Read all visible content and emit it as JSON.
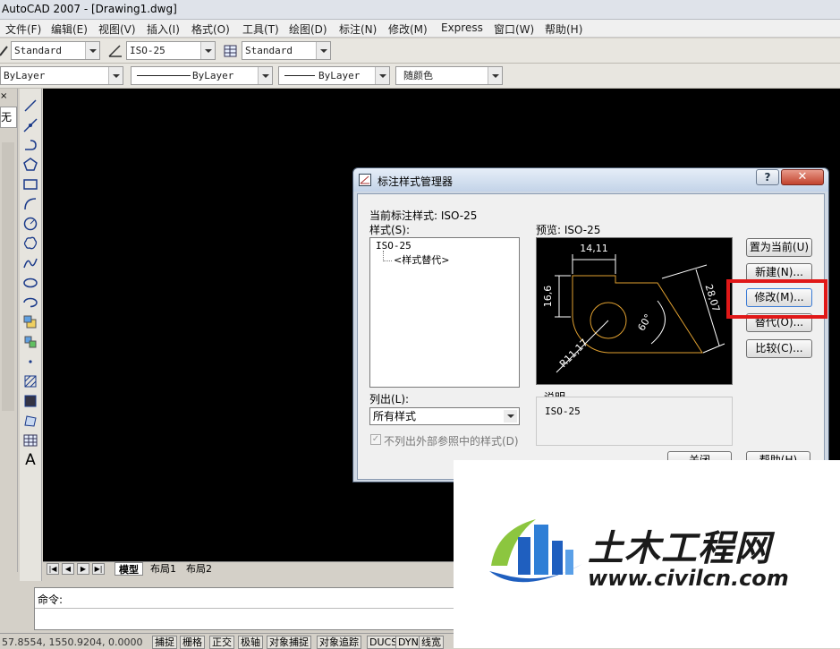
{
  "window": {
    "title": "AutoCAD 2007 - [Drawing1.dwg]"
  },
  "menu": [
    "文件(F)",
    "编辑(E)",
    "视图(V)",
    "插入(I)",
    "格式(O)",
    "工具(T)",
    "绘图(D)",
    "标注(N)",
    "修改(M)",
    "Express",
    "窗口(W)",
    "帮助(H)"
  ],
  "toolbar1": {
    "text_style": "Standard",
    "dim_style": "ISO-25",
    "table_style": "Standard"
  },
  "toolbar2": {
    "layer": "ByLayer",
    "linetype": "ByLayer",
    "lineweight": "ByLayer",
    "color": "随颜色"
  },
  "left_panel": {
    "label": "无"
  },
  "layout_tabs": [
    "模型",
    "布局1",
    "布局2"
  ],
  "command": {
    "prompt": "命令:"
  },
  "status": {
    "coords": "57.8554, 1550.9204, 0.0000",
    "buttons": [
      "捕捉",
      "栅格",
      "正交",
      "极轴",
      "对象捕捉",
      "对象追踪",
      "DUCS",
      "DYN",
      "线宽"
    ]
  },
  "dialog": {
    "title": "标注样式管理器",
    "current_style_label": "当前标注样式: ISO-25",
    "styles_label": "样式(S):",
    "styles": [
      "ISO-25",
      "<样式替代>"
    ],
    "preview_label": "预览: ISO-25",
    "list_label": "列出(L):",
    "list_value": "所有样式",
    "checkbox_label": "不列出外部参照中的样式(D)",
    "description_label": "说明",
    "description_value": "ISO-25",
    "buttons": {
      "set_current": "置为当前(U)",
      "new": "新建(N)...",
      "modify": "修改(M)...",
      "override": "替代(O)...",
      "compare": "比较(C)...",
      "close": "关闭",
      "help": "帮助(H)"
    },
    "preview_dims": {
      "d1": "14,11",
      "d2": "16,6",
      "d3": "28,07",
      "d4": "60°",
      "d5": "R11,17"
    }
  },
  "watermark": {
    "brand": "土木工程网",
    "url": "www.civilcn.com"
  },
  "colors": {
    "canvas": "#000000",
    "highlight": "#e01818",
    "preview_lines": "#e0a030",
    "dim_lines": "#ffffff"
  }
}
